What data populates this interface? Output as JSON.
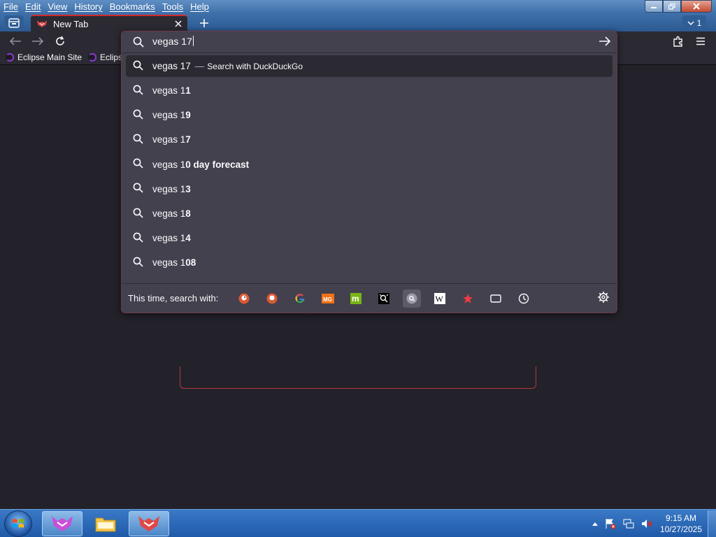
{
  "menubar": {
    "items": [
      "File",
      "Edit",
      "View",
      "History",
      "Bookmarks",
      "Tools",
      "Help"
    ]
  },
  "window_controls": {
    "minimize_icon": "minimize-icon",
    "restore_icon": "restore-icon",
    "close_icon": "close-icon"
  },
  "tabs": [
    {
      "title": "New Tab",
      "favicon": "browser-fox-icon"
    }
  ],
  "tab_counter": {
    "label": "1",
    "icon": "chevron-down-icon"
  },
  "bookmarks": [
    {
      "label": "Eclipse Main Site"
    },
    {
      "label": "Eclips"
    }
  ],
  "urlbar": {
    "value": "vegas 17",
    "suggestions": [
      {
        "prefix": "vegas 17",
        "bold": "",
        "separator": "—",
        "action": "Search with DuckDuckGo",
        "selected": true
      },
      {
        "prefix": "vegas 1",
        "bold": "1"
      },
      {
        "prefix": "vegas 1",
        "bold": "9"
      },
      {
        "prefix": "vegas 1",
        "bold": "7"
      },
      {
        "prefix": "vegas 1",
        "bold": "0 day forecast"
      },
      {
        "prefix": "vegas 1",
        "bold": "3"
      },
      {
        "prefix": "vegas 1",
        "bold": "8"
      },
      {
        "prefix": "vegas 1",
        "bold": "4"
      },
      {
        "prefix": "vegas 1",
        "bold": "08"
      }
    ],
    "one_offs_label": "This time, search with:",
    "engines": [
      "duckduckgo-icon",
      "duckduckgo-lite-icon",
      "google-icon",
      "metager-icon",
      "mojeek-icon",
      "searx-icon",
      "local-search-icon",
      "wikipedia-icon",
      "bookmarks-star-icon",
      "tabs-icon",
      "history-clock-icon"
    ]
  },
  "taskbar": {
    "clock_time": "9:15 AM",
    "clock_date": "10/27/2025"
  },
  "colors": {
    "accent": "#d02b2b",
    "panel": "#42414d",
    "page": "#23222b",
    "taskbar": "#2c66b2"
  }
}
